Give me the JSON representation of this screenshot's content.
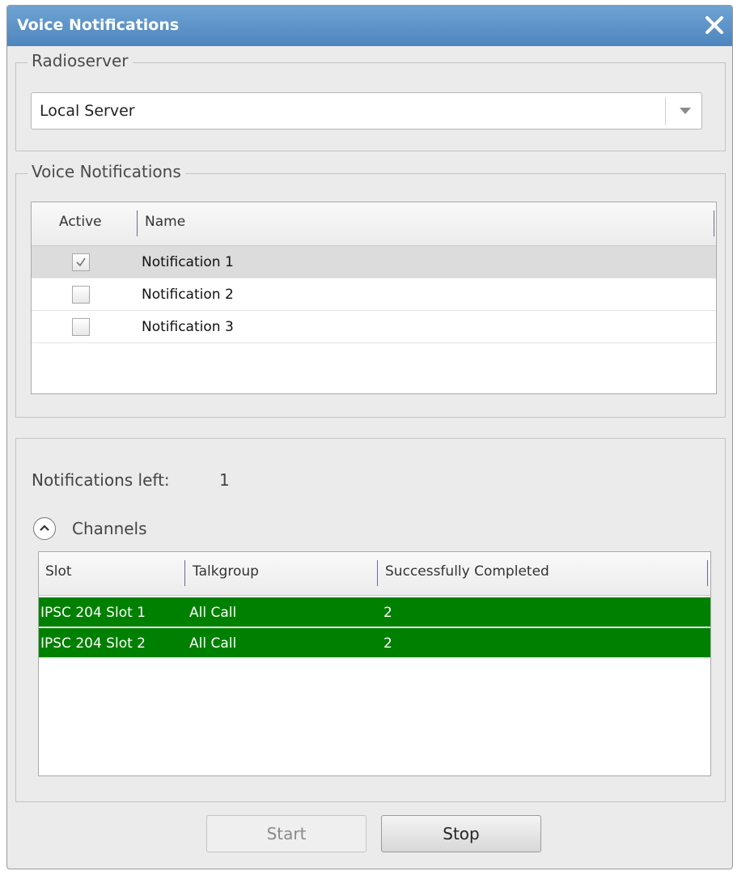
{
  "window": {
    "title": "Voice Notifications",
    "close_icon": "close-icon"
  },
  "radioserver": {
    "legend": "Radioserver",
    "selected": "Local Server"
  },
  "voice_notifications": {
    "legend": "Voice Notifications",
    "columns": [
      "Active",
      "Name"
    ],
    "rows": [
      {
        "active": true,
        "name": "Notification 1"
      },
      {
        "active": false,
        "name": "Notification 2"
      },
      {
        "active": false,
        "name": "Notification 3"
      }
    ]
  },
  "status": {
    "notifications_left_label": "Notifications left:",
    "notifications_left_value": "1",
    "channels_label": "Channels"
  },
  "channels_table": {
    "columns": [
      "Slot",
      "Talkgroup",
      "Successfully Completed"
    ],
    "rows": [
      {
        "slot": "IPSC 204 Slot 1",
        "talkgroup": "All Call",
        "completed": "2"
      },
      {
        "slot": "IPSC 204 Slot 2",
        "talkgroup": "All Call",
        "completed": "2"
      }
    ],
    "row_color": "#008000"
  },
  "buttons": {
    "start": "Start",
    "stop": "Stop"
  },
  "colors": {
    "titlebar": "#5a91c8",
    "success_row": "#008000"
  }
}
